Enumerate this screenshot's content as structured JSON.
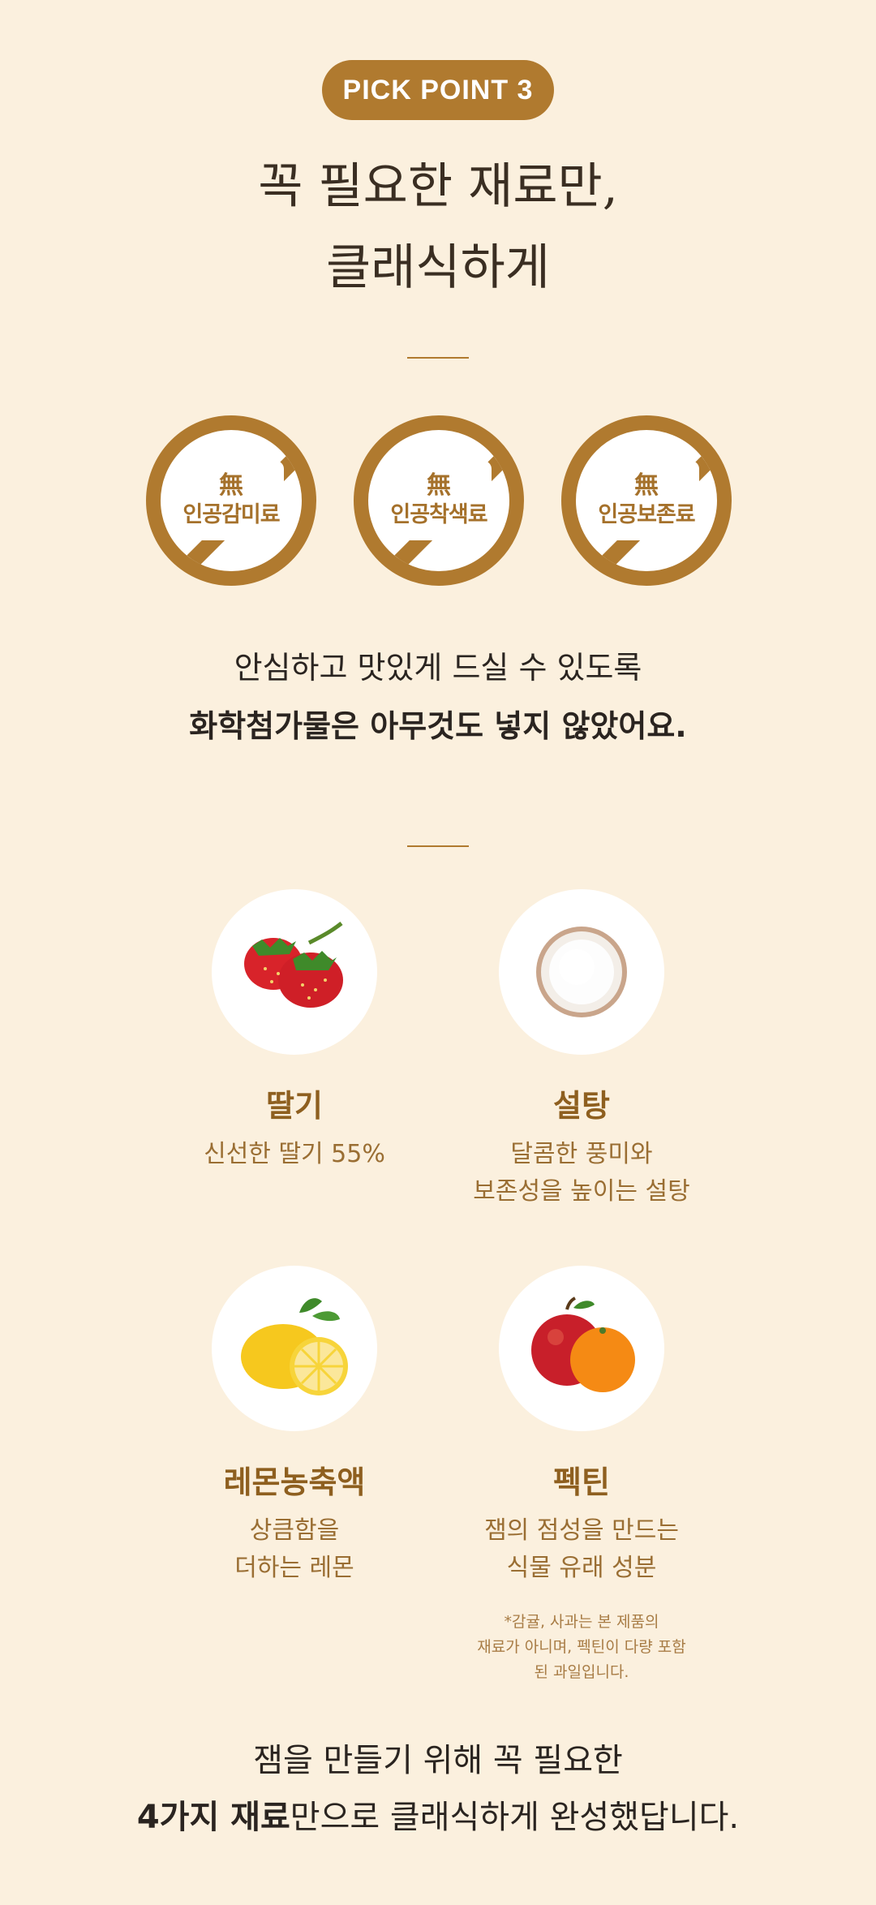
{
  "header": {
    "pill": "PICK POINT 3",
    "headline_line1": "꼭 필요한 재료만,",
    "headline_line2": "클래식하게"
  },
  "badges": [
    {
      "mu": "無",
      "label": "인공감미료"
    },
    {
      "mu": "無",
      "label": "인공착색료"
    },
    {
      "mu": "無",
      "label": "인공보존료"
    }
  ],
  "reassurance": {
    "line1": "안심하고 맛있게 드실 수 있도록",
    "line2": "화학첨가물은 아무것도 넣지 않았어요."
  },
  "ingredients": [
    {
      "name": "딸기",
      "desc_line1": "신선한 딸기 55%",
      "desc_line2": ""
    },
    {
      "name": "설탕",
      "desc_line1": "달콤한 풍미와",
      "desc_line2": "보존성을 높이는 설탕"
    },
    {
      "name": "레몬농축액",
      "desc_line1": "상큼함을",
      "desc_line2": "더하는 레몬"
    },
    {
      "name": "펙틴",
      "desc_line1": "잼의 점성을 만드는",
      "desc_line2": "식물 유래 성분"
    }
  ],
  "pectin_note": {
    "line1": "*감귤, 사과는 본 제품의",
    "line2": "재료가 아니며, 펙틴이 다량 포함",
    "line3": "된 과일입니다."
  },
  "closing": {
    "line1": "잼을 만들기 위해 꼭 필요한",
    "line2_bold": "4가지 재료",
    "line2_rest": "만으로 클래식하게 완성했답니다."
  },
  "colors": {
    "background": "#fbf0de",
    "accent": "#b07a2f",
    "ingredient_text": "#8e5f1f"
  },
  "icons": [
    "strawberry-image",
    "sugar-bowl-image",
    "lemon-image",
    "apple-orange-image"
  ]
}
